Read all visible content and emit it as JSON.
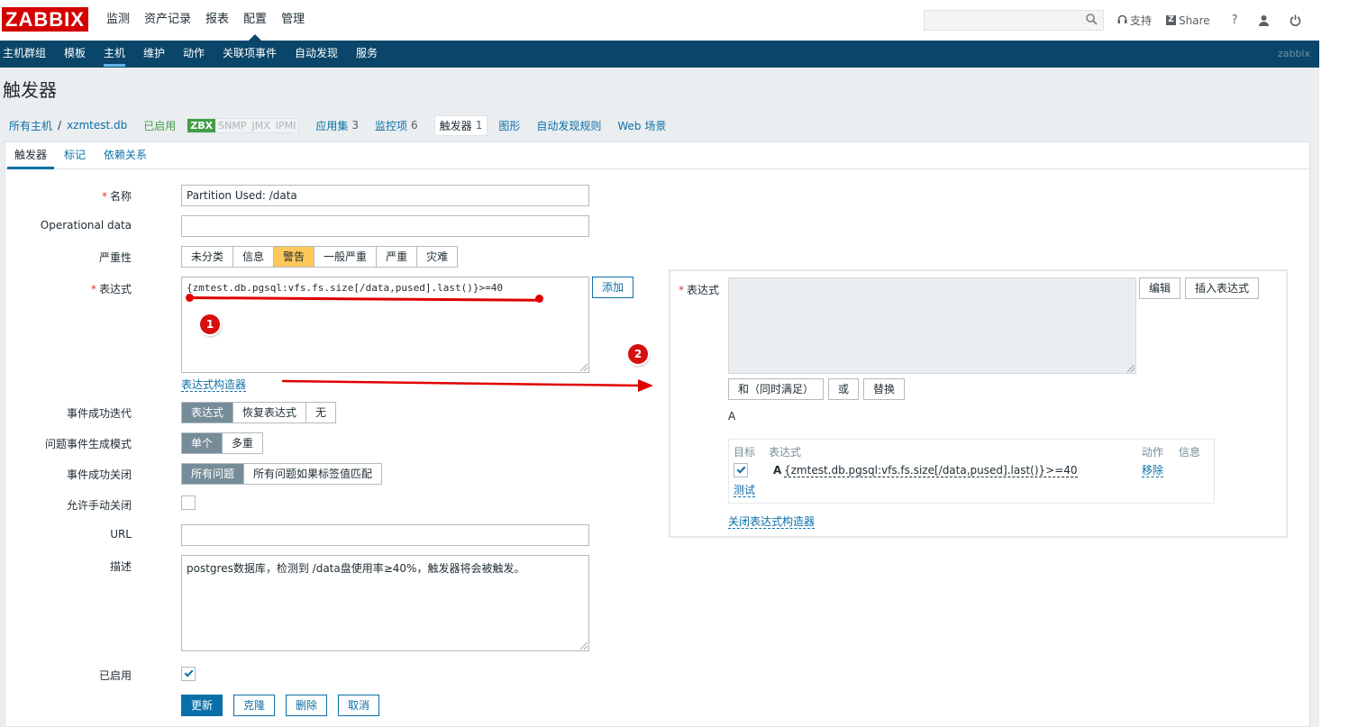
{
  "brand": {
    "logo_text": "ZABBIX",
    "logo_color": "#d40000",
    "accent": "#0a466a",
    "link": "#0a6fa8"
  },
  "topmenu": [
    "监测",
    "资产记录",
    "报表",
    "配置",
    "管理"
  ],
  "top_links": {
    "support": "支持",
    "share": "Share",
    "help": "?"
  },
  "subnav": {
    "items": [
      "主机群组",
      "模板",
      "主机",
      "维护",
      "动作",
      "关联项事件",
      "自动发现",
      "服务"
    ],
    "user": "zabbix"
  },
  "page_title": "触发器",
  "breadcrumb": {
    "all_hosts": "所有主机",
    "separator": "/",
    "host": "xzmtest.db",
    "status": "已启用",
    "availability": [
      "ZBX",
      "SNMP",
      "JMX",
      "IPMI"
    ],
    "applications": "应用集",
    "applications_count": "3",
    "items": "监控项",
    "items_count": "6",
    "triggers": "触发器",
    "triggers_count": "1",
    "graphs": "图形",
    "discovery": "自动发现规则",
    "web": "Web 场景"
  },
  "tabs": [
    "触发器",
    "标记",
    "依赖关系"
  ],
  "form": {
    "name_label": "名称",
    "name_value": "Partition Used: /data",
    "opdata_label": "Operational data",
    "opdata_value": "",
    "severity_label": "严重性",
    "severities": [
      "未分类",
      "信息",
      "警告",
      "一般严重",
      "严重",
      "灾难"
    ],
    "severity_selected": "警告",
    "expr_label": "表达式",
    "expr_value": "{zmtest.db.pgsql:vfs.fs.size[/data,pused].last()}>=40",
    "add_button": "添加",
    "constructor_link": "表达式构造器",
    "recovery_label": "事件成功迭代",
    "recovery_options": [
      "表达式",
      "恢复表达式",
      "无"
    ],
    "generation_label": "问题事件生成模式",
    "generation_options": [
      "单个",
      "多重"
    ],
    "close_label": "事件成功关闭",
    "close_options": [
      "所有问题",
      "所有问题如果标签值匹配"
    ],
    "manual_close_label": "允许手动关闭",
    "url_label": "URL",
    "url_value": "",
    "desc_label": "描述",
    "desc_value": "postgres数据库，检测到 /data盘使用率≥40%，触发器将会被触发。",
    "enabled_label": "已启用",
    "buttons": {
      "update": "更新",
      "clone": "克隆",
      "delete": "删除",
      "cancel": "取消"
    }
  },
  "constructor": {
    "label": "表达式",
    "edit_button": "编辑",
    "insert_button": "插入表达式",
    "and_button": "和（同时满足）",
    "or_button": "或",
    "replace_button": "替换",
    "formula": "A",
    "table": {
      "headers": {
        "target": "目标",
        "expression": "表达式",
        "action": "动作",
        "info": "信息"
      },
      "row": {
        "letter": "A",
        "expression": "{zmtest.db.pgsql:vfs.fs.size[/data,pused].last()}>=40",
        "remove": "移除"
      },
      "test": "测试"
    },
    "close_link": "关闭表达式构造器"
  },
  "annotations": {
    "marker1": "1",
    "marker2": "2"
  }
}
